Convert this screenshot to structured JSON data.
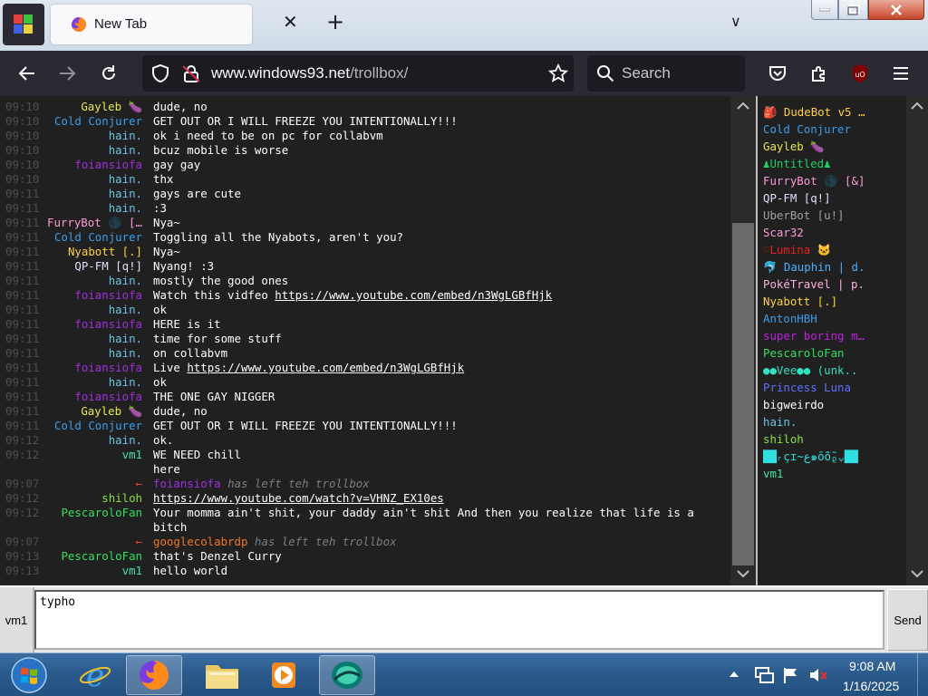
{
  "browser": {
    "tab_title": "New Tab",
    "tab_close": "✕",
    "new_tab": "+",
    "tab_list": "∨",
    "url_domain": "www.windows93.net",
    "url_path": "/trollbox/",
    "search_placeholder": "Search"
  },
  "chat": {
    "messages": [
      {
        "time": "09:10",
        "nick": "Gayleb 🍆",
        "color": "#e8e84a",
        "text": "dude, no"
      },
      {
        "time": "09:10",
        "nick": "Cold Conjurer",
        "color": "#3d9de8",
        "text": "GET OUT OR I WILL FREEZE YOU INTENTIONALLY!!!"
      },
      {
        "time": "09:10",
        "nick": "hain.",
        "color": "#6fc3e8",
        "text": "ok i need to be on pc for collabvm"
      },
      {
        "time": "09:10",
        "nick": "hain.",
        "color": "#6fc3e8",
        "text": "bcuz mobile is worse"
      },
      {
        "time": "09:10",
        "nick": "foiansiofa",
        "color": "#a22fe0",
        "text": "gay gay"
      },
      {
        "time": "09:10",
        "nick": "hain.",
        "color": "#6fc3e8",
        "text": "thx"
      },
      {
        "time": "09:11",
        "nick": "hain.",
        "color": "#6fc3e8",
        "text": "gays are cute"
      },
      {
        "time": "09:11",
        "nick": "hain.",
        "color": "#6fc3e8",
        "text": ":3"
      },
      {
        "time": "09:11",
        "nick": "FurryBot 🌑 [&]",
        "color": "#ff9ad6",
        "text": "Nya~"
      },
      {
        "time": "09:11",
        "nick": "Cold Conjurer",
        "color": "#3d9de8",
        "text": "Toggling all the Nyabots, aren't you?"
      },
      {
        "time": "09:11",
        "nick": "Nyabott [.]",
        "color": "#ffd040",
        "text": "Nya~"
      },
      {
        "time": "09:11",
        "nick": "QP-FM [q!]",
        "color": "#e0e0ff",
        "text": "Nyang! :3"
      },
      {
        "time": "09:11",
        "nick": "hain.",
        "color": "#6fc3e8",
        "text": "mostly the good ones"
      },
      {
        "time": "09:11",
        "nick": "foiansiofa",
        "color": "#a22fe0",
        "text": "Watch this vidfeo ",
        "link": "https://www.youtube.com/embed/n3WgLGBfHjk"
      },
      {
        "time": "09:11",
        "nick": "hain.",
        "color": "#6fc3e8",
        "text": "ok"
      },
      {
        "time": "09:11",
        "nick": "foiansiofa",
        "color": "#a22fe0",
        "text": "HERE is it"
      },
      {
        "time": "09:11",
        "nick": "hain.",
        "color": "#6fc3e8",
        "text": "time for some stuff"
      },
      {
        "time": "09:11",
        "nick": "hain.",
        "color": "#6fc3e8",
        "text": "on collabvm"
      },
      {
        "time": "09:11",
        "nick": "foiansiofa",
        "color": "#a22fe0",
        "text": "Live ",
        "link": "https://www.youtube.com/embed/n3WgLGBfHjk"
      },
      {
        "time": "09:11",
        "nick": "hain.",
        "color": "#6fc3e8",
        "text": "ok"
      },
      {
        "time": "09:11",
        "nick": "foiansiofa",
        "color": "#a22fe0",
        "text": "THE ONE GAY NIGGER"
      },
      {
        "time": "09:11",
        "nick": "Gayleb 🍆",
        "color": "#e8e84a",
        "text": "dude, no"
      },
      {
        "time": "09:11",
        "nick": "Cold Conjurer",
        "color": "#3d9de8",
        "text": "GET OUT OR I WILL FREEZE YOU INTENTIONALLY!!!"
      },
      {
        "time": "09:12",
        "nick": "hain.",
        "color": "#6fc3e8",
        "text": "ok."
      },
      {
        "time": "09:12",
        "nick": "vm1",
        "color": "#44e0a0",
        "text": "WE NEED chill"
      },
      {
        "time": "",
        "nick": "",
        "color": "#44e0a0",
        "text": "here"
      },
      {
        "time": "09:07",
        "nick": "←",
        "color": "#e84040",
        "system": true,
        "who": "foiansiofa",
        "who_color": "#a22fe0",
        "text": " has left teh trollbox"
      },
      {
        "time": "09:12",
        "nick": "shiloh",
        "color": "#88e040",
        "text": "",
        "link": "https://www.youtube.com/watch?v=VHNZ_EX10es"
      },
      {
        "time": "09:12",
        "nick": "PescaroloFan",
        "color": "#30e060",
        "text": "Your momma ain't shit, your daddy ain't shit And then you realize that life is a bitch",
        "wrap": true
      },
      {
        "time": "09:07",
        "nick": "←",
        "color": "#e84040",
        "system": true,
        "who": "googlecolabrdp",
        "who_color": "#f07820",
        "text": " has left teh trollbox"
      },
      {
        "time": "09:13",
        "nick": "PescaroloFan",
        "color": "#30e060",
        "text": "that's Denzel Curry"
      },
      {
        "time": "09:13",
        "nick": "vm1",
        "color": "#44e0a0",
        "text": "hello world"
      }
    ]
  },
  "users": [
    {
      "name": "🎒 DudeBot v5 [#]",
      "color": "#ffd040"
    },
    {
      "name": "Cold Conjurer",
      "color": "#3d9de8"
    },
    {
      "name": "Gayleb 🍆",
      "color": "#e8e84a"
    },
    {
      "name": "♟Untitled♟",
      "color": "#20d060"
    },
    {
      "name": "FurryBot 🌑 [&]",
      "color": "#ff9ad6"
    },
    {
      "name": "QP-FM [q!]",
      "color": "#e0e0ff"
    },
    {
      "name": "UberBot [u!]",
      "color": "#a0a0a0"
    },
    {
      "name": "Scar32",
      "color": "#ff9ad6"
    },
    {
      "name": "♡Lumina 🐱",
      "color": "#e82020"
    },
    {
      "name": "🐬 Dauphin | d.",
      "color": "#4ab0ff"
    },
    {
      "name": "PokéTravel | p.",
      "color": "#ffb0e0"
    },
    {
      "name": "Nyabott [.]",
      "color": "#ffd040"
    },
    {
      "name": "AntonHBH",
      "color": "#3d9de8"
    },
    {
      "name": "super boring m..",
      "color": "#c020e0"
    },
    {
      "name": "PescaroloFan",
      "color": "#30e060"
    },
    {
      "name": "●●Vee●● (unk..",
      "color": "#30e0c0"
    },
    {
      "name": "Princess Luna",
      "color": "#6070ff"
    },
    {
      "name": "bigweirdo",
      "color": "#ffffff"
    },
    {
      "name": "hain.",
      "color": "#6fc3e8"
    },
    {
      "name": "shiloh",
      "color": "#88e040"
    },
    {
      "name": "██ᵣçɪ~ﻉ๑ō̃ō̃ᵨ⌄██",
      "color": "#30e0e0"
    },
    {
      "name": "vm1",
      "color": "#44e0a0"
    }
  ],
  "input": {
    "nick": "vm1",
    "value": "typho",
    "send_label": "Send"
  },
  "taskbar": {
    "time": "9:08 AM",
    "date": "1/16/2025"
  }
}
